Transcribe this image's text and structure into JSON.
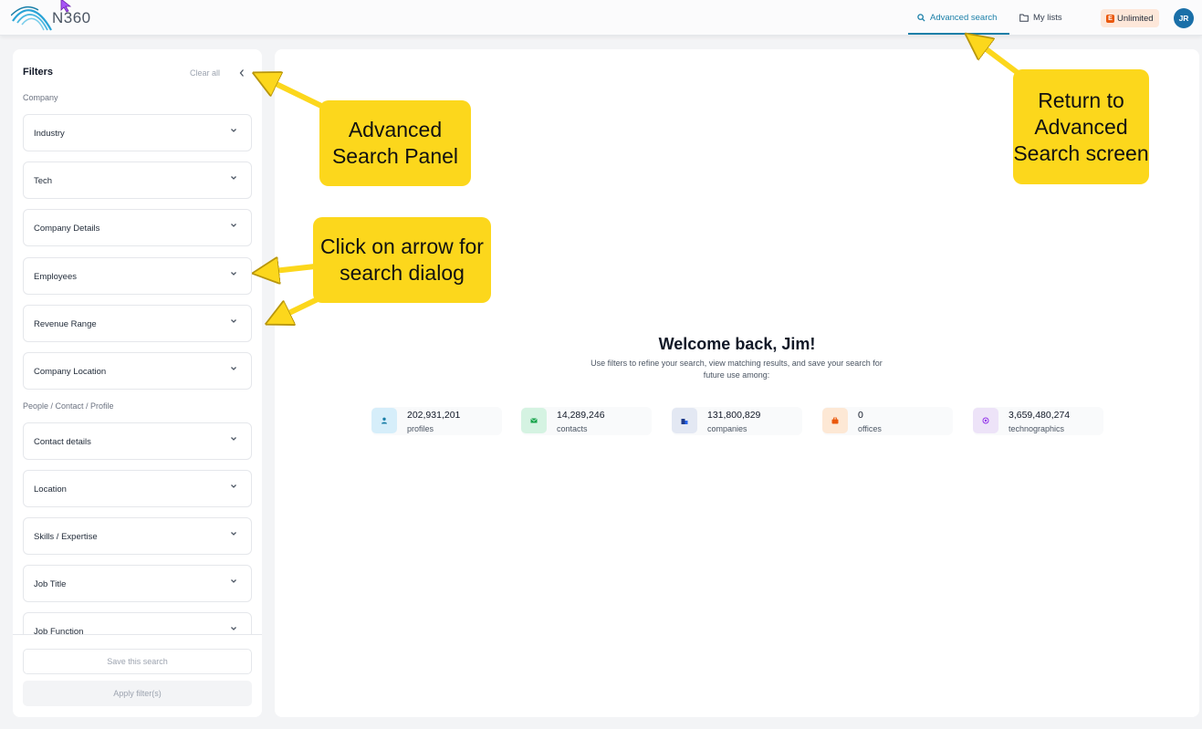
{
  "header": {
    "logo_text": "N360",
    "nav": {
      "advanced_search": "Advanced search",
      "my_lists": "My lists"
    },
    "plan_badge": "Unlimited",
    "avatar_initials": "JR"
  },
  "sidebar": {
    "title": "Filters",
    "clear_all": "Clear all",
    "collapse_icon": "chevron-left-icon",
    "sections": {
      "company": "Company",
      "people": "People / Contact / Profile"
    },
    "filters": [
      "Industry",
      "Tech",
      "Company Details",
      "Employees",
      "Revenue Range",
      "Company Location",
      "Contact details",
      "Location",
      "Skills / Expertise",
      "Job Title",
      "Job Function"
    ],
    "save_button": "Save this search",
    "apply_button": "Apply filter(s)"
  },
  "main": {
    "welcome_title": "Welcome back, Jim!",
    "welcome_subtitle": "Use filters to refine your search, view matching results, and save your search for future use among:",
    "stats": [
      {
        "value": "202,931,201",
        "label": "profiles",
        "icon": "person-icon",
        "color": "#d6eefa"
      },
      {
        "value": "14,289,246",
        "label": "contacts",
        "icon": "envelope-icon",
        "color": "#d5f3e2"
      },
      {
        "value": "131,800,829",
        "label": "companies",
        "icon": "building-icon",
        "color": "#e3e8f3"
      },
      {
        "value": "0",
        "label": "offices",
        "icon": "briefcase-icon",
        "color": "#fde8d5"
      },
      {
        "value": "3,659,480,274",
        "label": "technographics",
        "icon": "chip-icon",
        "color": "#ede3f8"
      }
    ]
  },
  "callouts": {
    "advanced_panel": "Advanced Search Panel",
    "click_arrow": "Click on arrow for search dialog",
    "return": "Return to Advanced Search screen"
  },
  "colors": {
    "accent": "#1a7fa8",
    "callout": "#fcd71c"
  }
}
